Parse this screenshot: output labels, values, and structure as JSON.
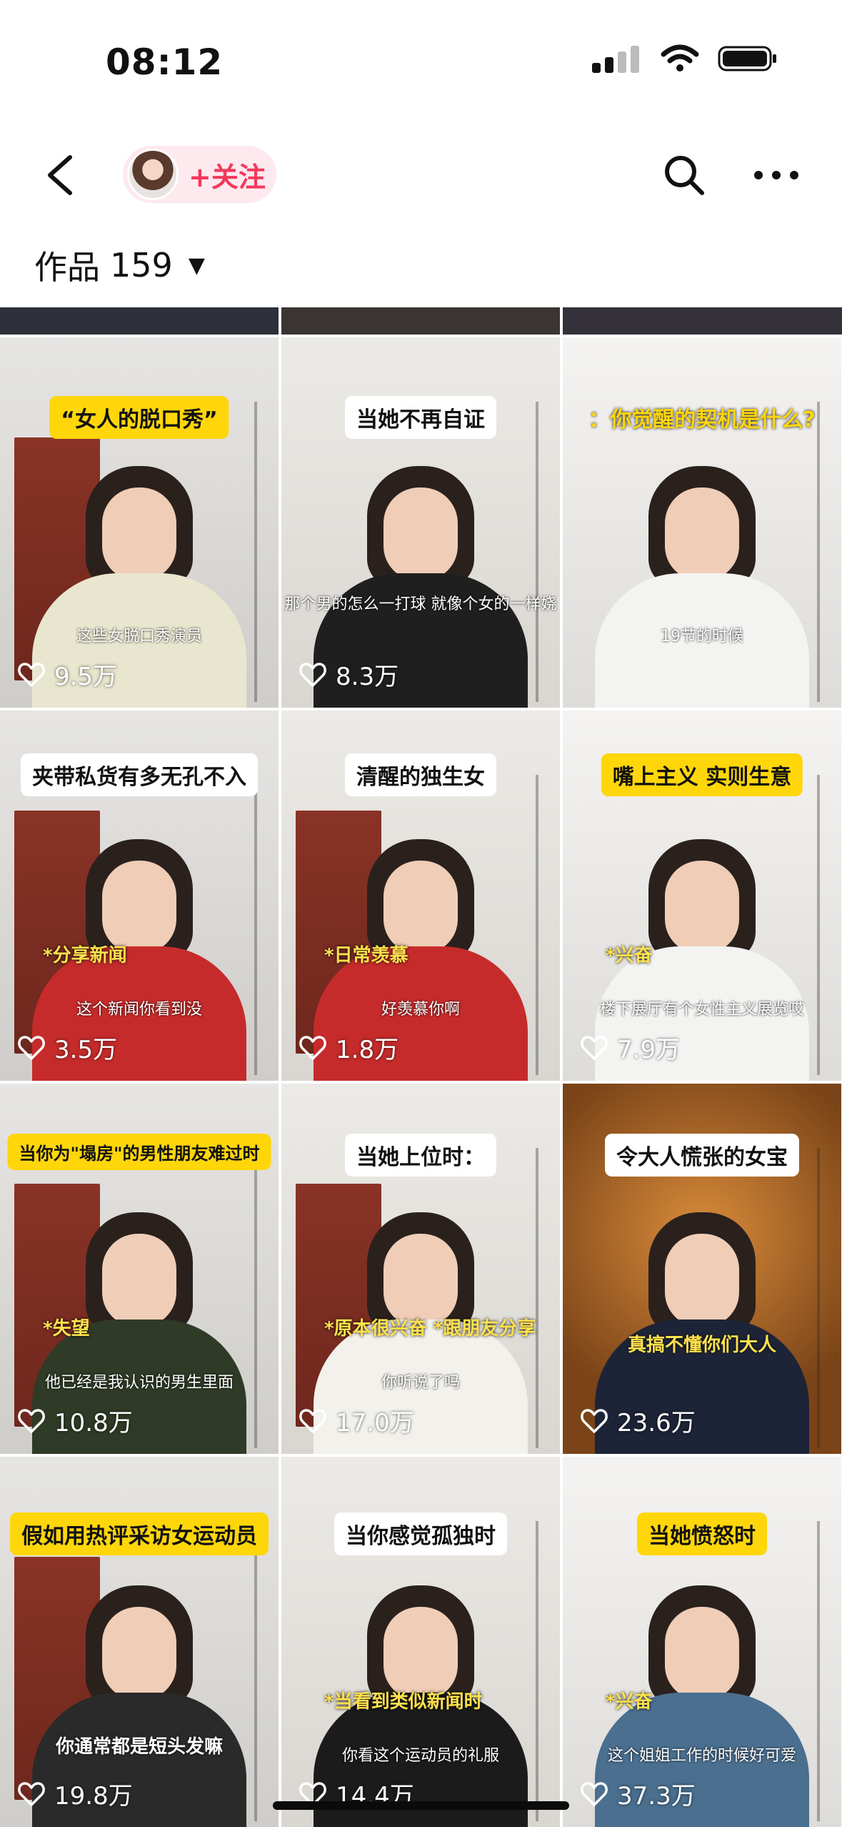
{
  "status": {
    "time": "08:12"
  },
  "header": {
    "follow_label": "+关注"
  },
  "works": {
    "label": "作品",
    "count": "159"
  },
  "videos": [
    {
      "top_caption": "“女人的脱口秀”",
      "caption_style": "yellow",
      "subtitle": "这些女脱口秀演员",
      "tag": "",
      "likes": "9.5万",
      "shirt": "#e9e6cf"
    },
    {
      "top_caption": "当她不再自证",
      "caption_style": "white",
      "subtitle": "那个男的怎么一打球 就像个女的一样娆",
      "tag": "",
      "likes": "8.3万",
      "shirt": "#1f1f1f"
    },
    {
      "top_caption": "：你觉醒的契机是什么?",
      "caption_style": "none",
      "subtitle": "19节的时候",
      "tag": "",
      "likes": "",
      "shirt": "#f3f3f1"
    },
    {
      "top_caption": "夹带私货有多无孔不入",
      "caption_style": "white",
      "subtitle": "这个新闻你看到没",
      "tag": "*分享新闻",
      "likes": "3.5万",
      "shirt": "#c62b2b"
    },
    {
      "top_caption": "清醒的独生女",
      "caption_style": "white",
      "subtitle": "好羡慕你啊",
      "tag": "*日常羡慕",
      "likes": "1.8万",
      "shirt": "#c62b2b"
    },
    {
      "top_caption": "嘴上主义 实则生意",
      "caption_style": "yellow",
      "subtitle": "楼下展厅有个女性主义展览哎",
      "tag": "*兴奋",
      "likes": "7.9万",
      "shirt": "#f3f3f1"
    },
    {
      "top_caption": "当你为\"塌房\"的男性朋友难过时",
      "caption_style": "yellow",
      "subtitle": "他已经是我认识的男生里面",
      "tag": "*失望",
      "likes": "10.8万",
      "shirt": "#2f3b26"
    },
    {
      "top_caption": "当她上位时：",
      "caption_style": "white",
      "subtitle": "你听说了吗",
      "tag": "*原本很兴奋 *跟朋友分享",
      "likes": "17.0万",
      "shirt": "#f3f1ec"
    },
    {
      "top_caption": "令大人慌张的女宝",
      "caption_style": "white",
      "subtitle": "真搞不懂你们大人",
      "tag": "",
      "likes": "23.6万",
      "shirt": "#1e2438"
    },
    {
      "top_caption": "假如用热评采访女运动员",
      "caption_style": "yellow",
      "subtitle": "你通常都是短头发嘛",
      "tag": "",
      "likes": "19.8万",
      "shirt": "#2a2a2a"
    },
    {
      "top_caption": "当你感觉孤独时",
      "caption_style": "white",
      "subtitle": "你看这个运动员的礼服",
      "tag": "*当看到类似新闻时",
      "likes": "14.4万",
      "shirt": "#1b1b1b"
    },
    {
      "top_caption": "当她愤怒时",
      "caption_style": "yellow",
      "subtitle": "这个姐姐工作的时候好可爱",
      "tag": "*兴奋",
      "likes": "37.3万",
      "shirt": "#4a6f8f"
    }
  ]
}
